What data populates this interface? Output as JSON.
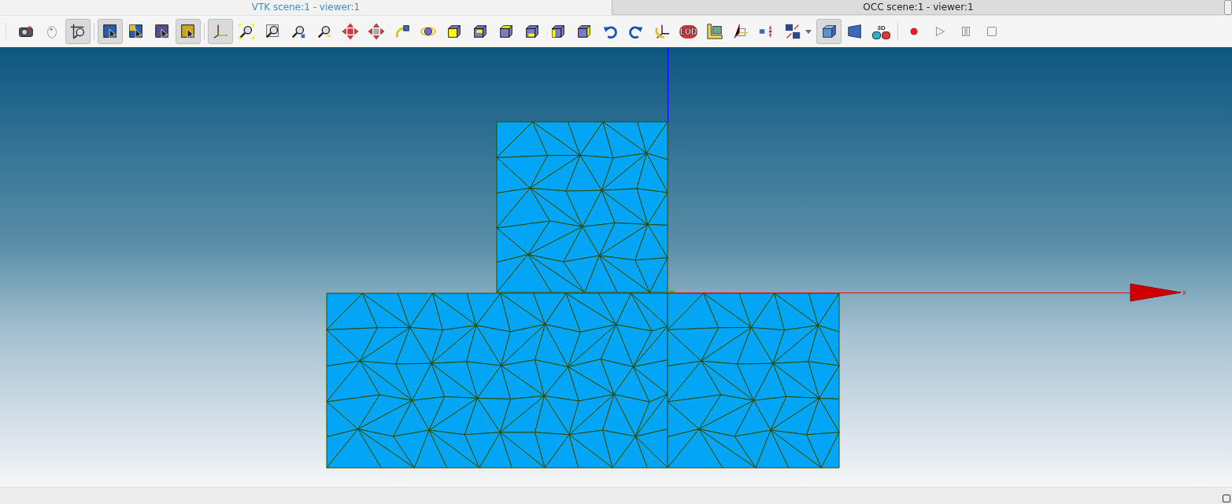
{
  "tabs": [
    {
      "label": "VTK scene:1 - viewer:1",
      "selected": true
    },
    {
      "label": "OCC scene:1 - viewer:1",
      "selected": false
    }
  ],
  "toolbar": {
    "tools": [
      {
        "kind": "camera",
        "selected": false
      },
      {
        "kind": "mouse",
        "selected": false
      },
      {
        "kind": "zoom-cross",
        "selected": true
      },
      {
        "kind": "separator"
      },
      {
        "kind": "select",
        "selected": true
      },
      {
        "kind": "select-multi",
        "selected": false
      },
      {
        "kind": "select-cross",
        "selected": false
      },
      {
        "kind": "select-highlight",
        "selected": true
      },
      {
        "kind": "separator"
      },
      {
        "kind": "axes",
        "selected": true
      },
      {
        "kind": "zoom-fit",
        "selected": false
      },
      {
        "kind": "zoom-area",
        "selected": false
      },
      {
        "kind": "zoom-small",
        "selected": false
      },
      {
        "kind": "zoom-in",
        "selected": false
      },
      {
        "kind": "pan",
        "selected": false
      },
      {
        "kind": "pan-global",
        "selected": false
      },
      {
        "kind": "rotate",
        "selected": false
      },
      {
        "kind": "rotation-point",
        "selected": false
      },
      {
        "kind": "cube-front",
        "selected": false
      },
      {
        "kind": "cube-back",
        "selected": false
      },
      {
        "kind": "cube-top",
        "selected": false
      },
      {
        "kind": "cube-bottom",
        "selected": false
      },
      {
        "kind": "cube-left",
        "selected": false
      },
      {
        "kind": "cube-right",
        "selected": false
      },
      {
        "kind": "undo",
        "selected": false
      },
      {
        "kind": "redo",
        "selected": false
      },
      {
        "kind": "reset-rotation",
        "selected": false
      },
      {
        "kind": "badge",
        "text": "LOD",
        "selected": false
      },
      {
        "kind": "ruler",
        "selected": false
      },
      {
        "kind": "clipping",
        "selected": false
      },
      {
        "kind": "explode",
        "selected": false
      },
      {
        "kind": "sync",
        "selected": false,
        "dropdown": true
      },
      {
        "kind": "shaded",
        "selected": true
      },
      {
        "kind": "perspective",
        "selected": false
      },
      {
        "kind": "stereo",
        "text": "3D",
        "selected": false
      },
      {
        "kind": "separator"
      },
      {
        "kind": "record",
        "selected": false
      },
      {
        "kind": "play",
        "selected": false
      },
      {
        "kind": "pause",
        "selected": false
      },
      {
        "kind": "stop",
        "selected": false
      }
    ]
  },
  "viewport": {
    "axis_label": "x"
  }
}
